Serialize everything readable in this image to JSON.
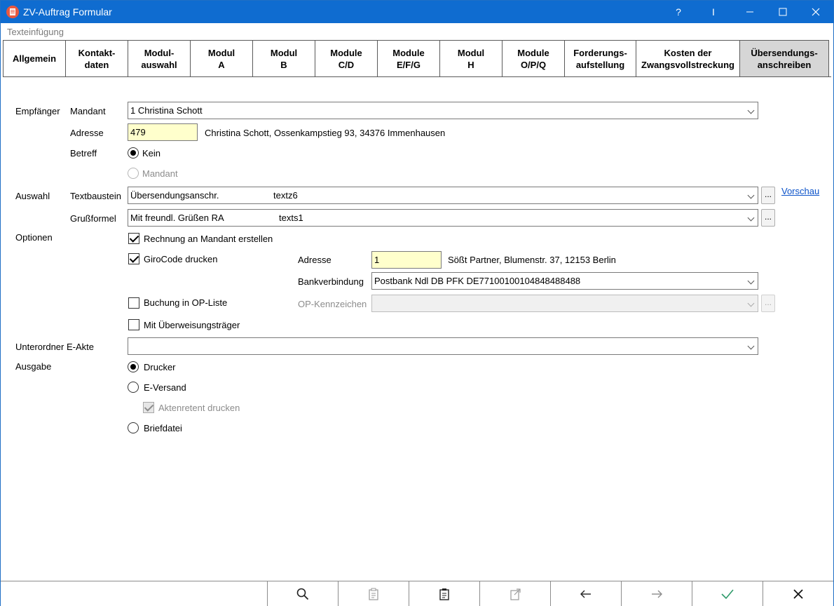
{
  "window": {
    "title": "ZV-Auftrag Formular",
    "help": "?",
    "controls": {
      "cursor": "I",
      "minimize": "—",
      "maximize": "☐",
      "close": "✕"
    }
  },
  "menu": {
    "label": "Texteinfügung"
  },
  "tabs": [
    {
      "label": "Allgemein"
    },
    {
      "label": "Kontakt-\ndaten"
    },
    {
      "label": "Modul-\nauswahl"
    },
    {
      "label": "Modul\nA"
    },
    {
      "label": "Modul\nB"
    },
    {
      "label": "Module\nC/D"
    },
    {
      "label": "Module\nE/F/G"
    },
    {
      "label": "Modul\nH"
    },
    {
      "label": "Module\nO/P/Q"
    },
    {
      "label": "Forderungs-\naufstellung"
    },
    {
      "label": "Kosten der\nZwangsvollstreckung"
    },
    {
      "label": "Übersendungs-\nanschreiben"
    }
  ],
  "form": {
    "empfaenger_label": "Empfänger",
    "mandant_label": "Mandant",
    "mandant_value": "1  Christina Schott",
    "adresse_label": "Adresse",
    "adresse_value": "479",
    "adresse_text": "Christina Schott, Ossenkampstieg 93, 34376 Immenhausen",
    "betreff_label": "Betreff",
    "betreff_kein": "Kein",
    "betreff_mandant": "Mandant",
    "auswahl_label": "Auswahl",
    "textbaustein_label": "Textbaustein",
    "textbaustein_value": "Übersendungsanschr.",
    "textbaustein_code": "textz6",
    "vorschau_link": "Vorschau",
    "grussformel_label": "Grußformel",
    "grussformel_value": "Mit freundl. Grüßen RA",
    "grussformel_code": "texts1",
    "optionen_label": "Optionen",
    "rechnung_label": "Rechnung an Mandant erstellen",
    "girocode_label": "GiroCode drucken",
    "giro_adresse_label": "Adresse",
    "giro_adresse_value": "1",
    "giro_adresse_text": "Sößt  Partner, Blumenstr. 37, 12153 Berlin",
    "bankverbindung_label": "Bankverbindung",
    "bankverbindung_value": "Postbank Ndl DB PFK DE77100100104848488488",
    "buchung_label": "Buchung in OP-Liste",
    "op_kennzeichen_label": "OP-Kennzeichen",
    "ueberweisung_label": "Mit Überweisungsträger",
    "unterordner_label": "Unterordner E-Akte",
    "ausgabe_label": "Ausgabe",
    "drucker_label": "Drucker",
    "eversand_label": "E-Versand",
    "aktenretent_label": "Aktenretent drucken",
    "briefdatei_label": "Briefdatei",
    "dots": "..."
  },
  "toolbar": {
    "icons": [
      "search-icon",
      "clipboard-icon",
      "document-icon",
      "export-icon",
      "arrow-left-icon",
      "arrow-right-icon",
      "confirm-check-icon",
      "close-icon"
    ]
  },
  "colors": {
    "titlebar": "#0f6cd0",
    "input_highlight": "#ffffcc",
    "link": "#0b52c9",
    "active_tab": "#d6d6d6",
    "confirm": "#2e9a6a"
  }
}
